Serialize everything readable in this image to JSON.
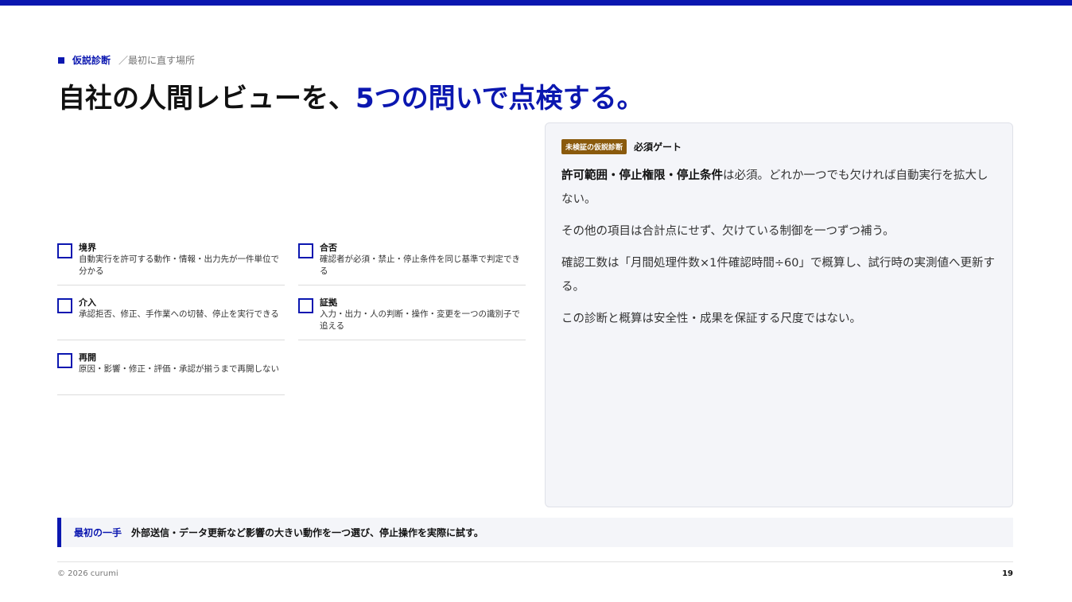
{
  "header": {
    "section": "仮説診断",
    "subsection": "／最初に直す場所"
  },
  "title": {
    "main": "自社の人間レビューを、",
    "highlight": "5つの問いで点検する。"
  },
  "checklist": [
    {
      "title": "境界",
      "desc": "自動実行を許可する動作・情報・出力先が一件単位で分かる"
    },
    {
      "title": "合否",
      "desc": "確認者が必須・禁止・停止条件を同じ基準で判定できる"
    },
    {
      "title": "介入",
      "desc": "承認拒否、修正、手作業への切替、停止を実行できる"
    },
    {
      "title": "証拠",
      "desc": "入力・出力・人の判断・操作・変更を一つの識別子で追える"
    },
    {
      "title": "再開",
      "desc": "原因・影響・修正・評価・承認が揃うまで再開しない"
    }
  ],
  "card": {
    "badge": "未検証の仮説診断",
    "gate": "必須ゲート",
    "p1_bold": "許可範囲・停止権限・停止条件",
    "p1_rest": "は必須。どれか一つでも欠ければ自動実行を拡大しない。",
    "p2": "その他の項目は合計点にせず、欠けている制御を一つずつ補う。",
    "p3": "確認工数は「月間処理件数×1件確認時間÷60」で概算し、試行時の実測値へ更新する。",
    "p4": "この診断と概算は安全性・成果を保証する尺度ではない。"
  },
  "first_step": {
    "label": "最初の一手",
    "text": "外部送信・データ更新など影響の大きい動作を一つ選び、停止操作を実際に試す。"
  },
  "footer": {
    "copyright": "© 2026 curumi",
    "page": "19"
  },
  "colors": {
    "accent": "#0b17b0",
    "badge": "#8a5a0d"
  }
}
